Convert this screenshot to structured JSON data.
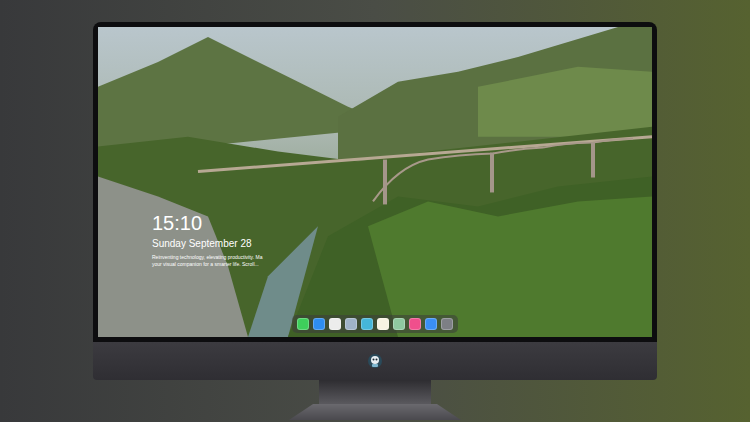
{
  "desktop": {
    "clock": "15:10",
    "date": "Sunday September 28",
    "tagline": [
      "Reinventing technology, elevating productivity. Ma",
      "your visual companion for a smarter life. Scroll..."
    ]
  },
  "dock": {
    "apps": [
      {
        "color": "#3ecf5b"
      },
      {
        "color": "#2e8df0"
      },
      {
        "color": "#ececec"
      },
      {
        "color": "#9fb3c8"
      },
      {
        "color": "#45b6d9"
      },
      {
        "color": "#f7f3e3"
      },
      {
        "color": "#8fc9a0"
      },
      {
        "color": "#f04f8c"
      },
      {
        "color": "#3a8ff5"
      },
      {
        "color": "#7d7f85"
      }
    ]
  }
}
